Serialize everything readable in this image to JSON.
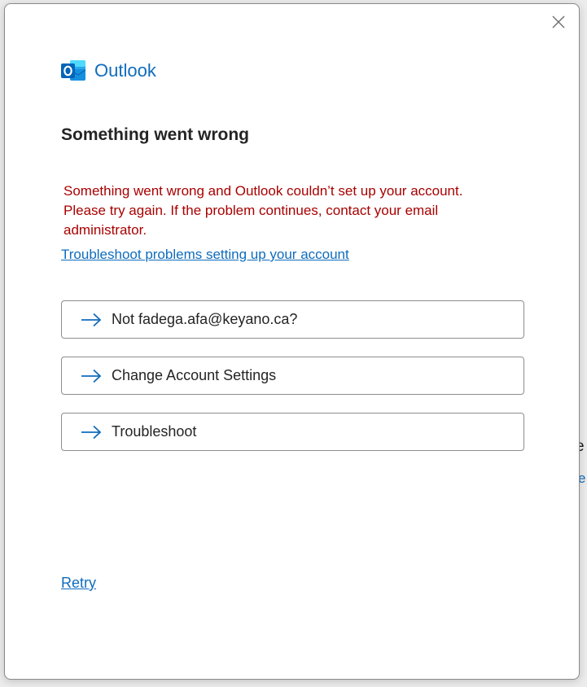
{
  "app": {
    "name": "Outlook",
    "brand_color": "#0f6cbd"
  },
  "dialog": {
    "title": "Something went wrong",
    "error_message": "Something went wrong and Outlook couldn’t set up your account. Please try again. If the problem continues, contact your email administrator.",
    "troubleshoot_link": "Troubleshoot problems setting up your account",
    "options": [
      {
        "label": "Not fadega.afa@keyano.ca?",
        "icon": "arrow-right-icon"
      },
      {
        "label": "Change Account Settings",
        "icon": "arrow-right-icon"
      },
      {
        "label": "Troubleshoot",
        "icon": "arrow-right-icon"
      }
    ],
    "retry_label": "Retry",
    "close_icon": "close-icon",
    "error_color": "#a80000"
  },
  "background": {
    "fragment_1": "e",
    "fragment_2": "e"
  }
}
